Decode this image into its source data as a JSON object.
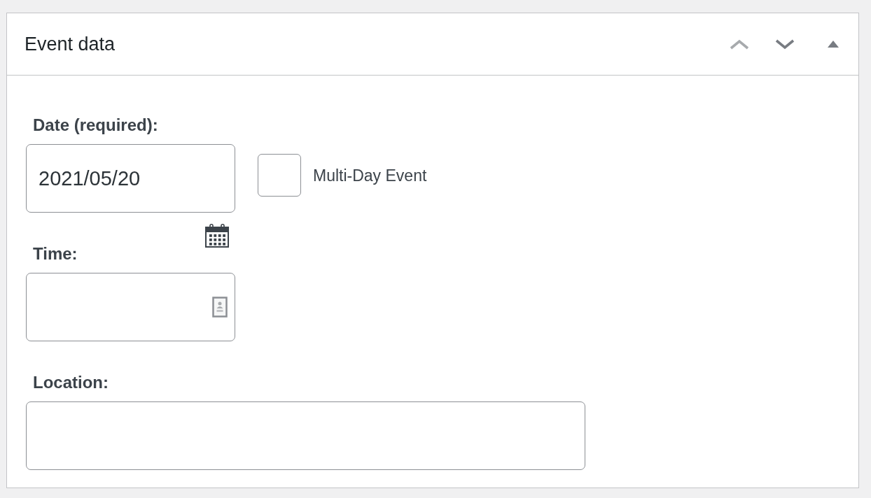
{
  "panel": {
    "title": "Event data",
    "controls": [
      {
        "kind": "move_up",
        "disabled": true
      },
      {
        "kind": "move_down",
        "disabled": false
      },
      {
        "kind": "toggle",
        "disabled": false
      }
    ]
  },
  "fields": [
    {
      "kind": "date",
      "label": "Date (required):",
      "value": "2021/05/20",
      "checkbox": {
        "label": "Multi-Day Event",
        "checked": false
      }
    },
    {
      "kind": "time",
      "label": "Time:"
    },
    {
      "kind": "text",
      "label": "Location:"
    }
  ]
}
